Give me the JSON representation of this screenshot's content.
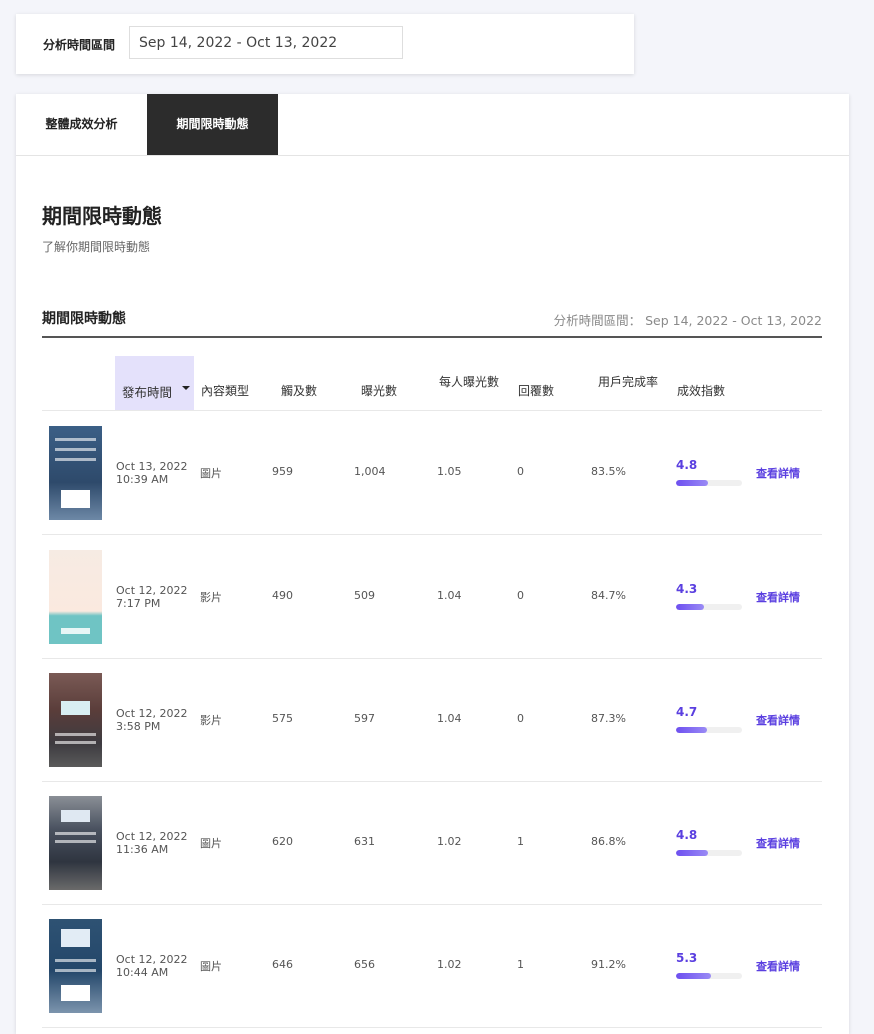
{
  "filter": {
    "label": "分析時間區間",
    "range": "Sep 14, 2022 - Oct 13, 2022"
  },
  "tabs": [
    {
      "label": "整體成效分析",
      "active": false
    },
    {
      "label": "期間限時動態",
      "active": true
    }
  ],
  "page": {
    "title": "期間限時動態",
    "subtitle": "了解你期間限時動態"
  },
  "section": {
    "title": "期間限時動態",
    "range_text": "分析時間區間： Sep 14, 2022 - Oct 13, 2022"
  },
  "table": {
    "headers": {
      "published": "發布時間",
      "type": "內容類型",
      "reach": "觸及數",
      "impressions": "曝光數",
      "per_person": "每人曝光數",
      "replies": "回覆數",
      "completion": "用戶完成率",
      "score": "成效指數"
    },
    "detail_label": "查看詳情",
    "rows": [
      {
        "date": "Oct 13, 2022",
        "time": "10:39 AM",
        "type": "圖片",
        "reach": "959",
        "impressions": "1,004",
        "per_person": "1.05",
        "replies": "0",
        "completion": "83.5%",
        "score": "4.8",
        "score_fraction": 0.48
      },
      {
        "date": "Oct 12, 2022",
        "time": "7:17 PM",
        "type": "影片",
        "reach": "490",
        "impressions": "509",
        "per_person": "1.04",
        "replies": "0",
        "completion": "84.7%",
        "score": "4.3",
        "score_fraction": 0.43
      },
      {
        "date": "Oct 12, 2022",
        "time": "3:58 PM",
        "type": "影片",
        "reach": "575",
        "impressions": "597",
        "per_person": "1.04",
        "replies": "0",
        "completion": "87.3%",
        "score": "4.7",
        "score_fraction": 0.47
      },
      {
        "date": "Oct 12, 2022",
        "time": "11:36 AM",
        "type": "圖片",
        "reach": "620",
        "impressions": "631",
        "per_person": "1.02",
        "replies": "1",
        "completion": "86.8%",
        "score": "4.8",
        "score_fraction": 0.48
      },
      {
        "date": "Oct 12, 2022",
        "time": "10:44 AM",
        "type": "圖片",
        "reach": "646",
        "impressions": "656",
        "per_person": "1.02",
        "replies": "1",
        "completion": "91.2%",
        "score": "5.3",
        "score_fraction": 0.53
      }
    ]
  },
  "colors": {
    "accent": "#5a3fe0",
    "active_tab": "#2c2c2c",
    "sort_header_bg": "#e4e1fb"
  }
}
